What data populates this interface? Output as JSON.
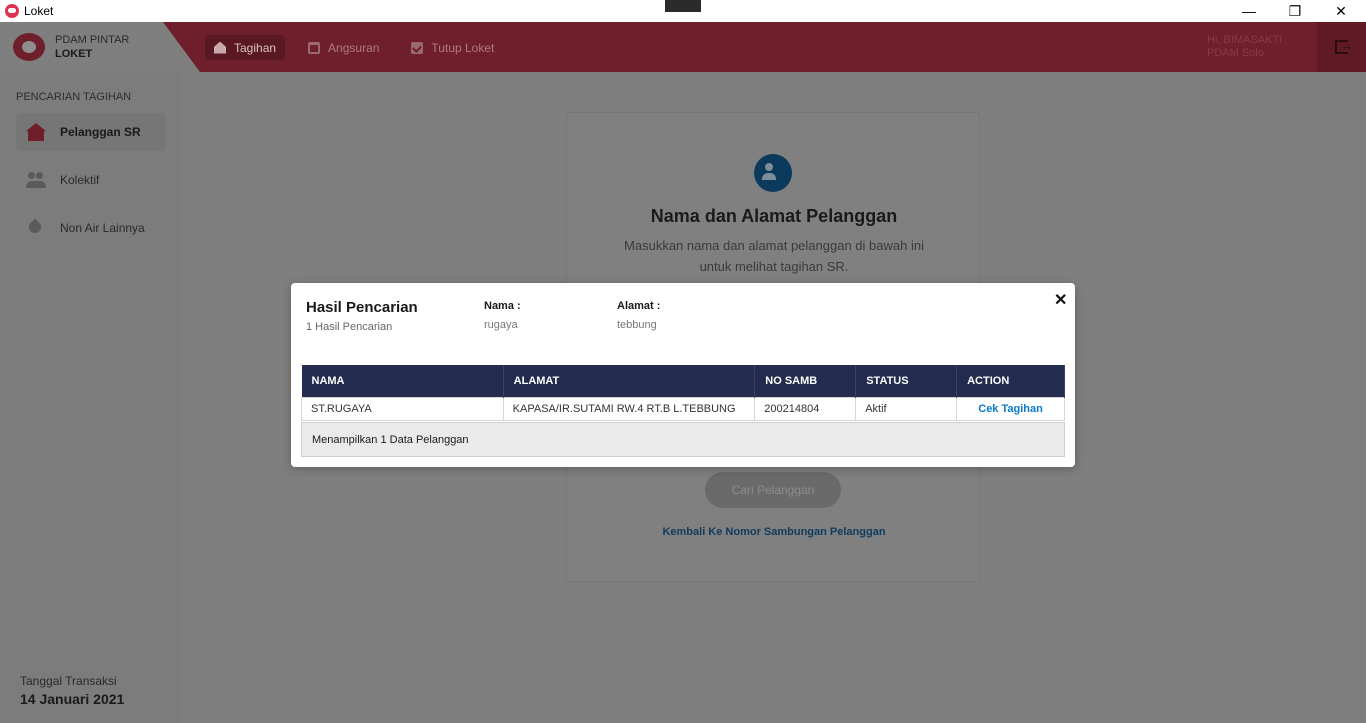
{
  "window": {
    "title": "Loket",
    "controls": {
      "minimize": "—",
      "maximize": "❐",
      "close": "✕"
    }
  },
  "brand": {
    "line1": "PDAM PINTAR",
    "line2": "LOKET"
  },
  "nav": [
    {
      "label": "Tagihan",
      "icon": "home-icon",
      "active": true
    },
    {
      "label": "Angsuran",
      "icon": "calendar-icon",
      "active": false
    },
    {
      "label": "Tutup Loket",
      "icon": "check-square-icon",
      "active": false
    }
  ],
  "user": {
    "greeting": "Hi, BIMASAKTI",
    "org": "PDAM Solo"
  },
  "sidebar": {
    "section": "PENCARIAN TAGIHAN",
    "items": [
      {
        "label": "Pelanggan SR",
        "icon": "house-icon"
      },
      {
        "label": "Kolektif",
        "icon": "people-icon"
      },
      {
        "label": "Non Air Lainnya",
        "icon": "drop-icon"
      }
    ],
    "date_label": "Tanggal Transaksi",
    "date_value": "14 Januari 2021"
  },
  "card": {
    "title": "Nama dan Alamat Pelanggan",
    "subtitle": "Masukkan nama dan alamat pelanggan di bawah ini untuk melihat tagihan SR.",
    "button": "Cari Pelanggan",
    "link": "Kembali Ke Nomor Sambungan Pelanggan"
  },
  "modal": {
    "title": "Hasil Pencarian",
    "count": "1 Hasil Pencarian",
    "nama_label": "Nama :",
    "nama_value": "rugaya",
    "alamat_label": "Alamat :",
    "alamat_value": "tebbung",
    "close": "✕",
    "columns": [
      "NAMA",
      "ALAMAT",
      "NO SAMB",
      "STATUS",
      "ACTION"
    ],
    "rows": [
      {
        "nama": "ST.RUGAYA",
        "alamat": "KAPASA/IR.SUTAMI RW.4 RT.B L.TEBBUNG",
        "no_samb": "200214804",
        "status": "Aktif",
        "action": "Cek Tagihan"
      }
    ],
    "footer": "Menampilkan 1 Data Pelanggan"
  }
}
